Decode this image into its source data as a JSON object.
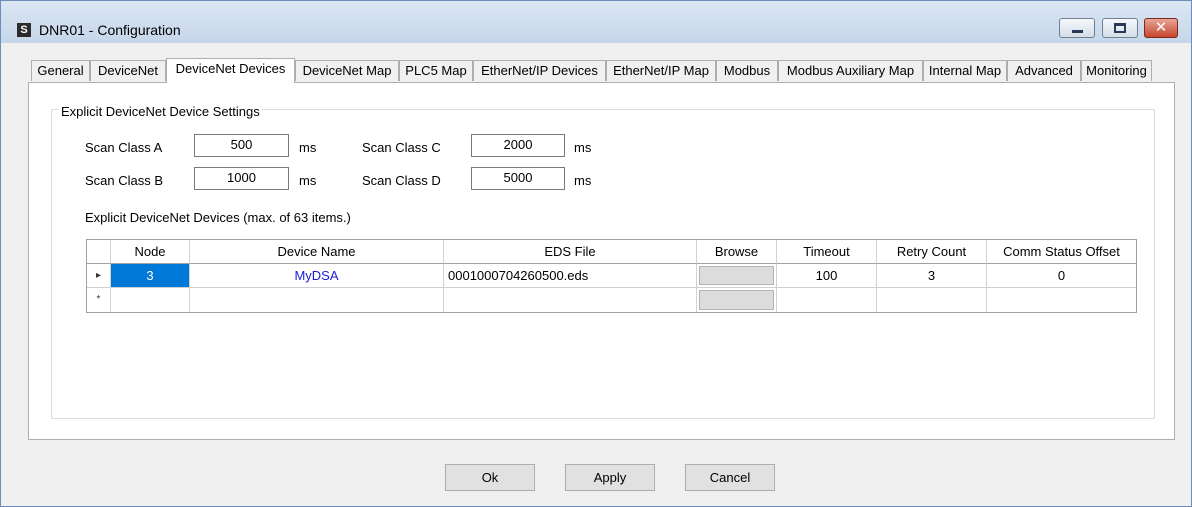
{
  "window": {
    "icon_glyph": "S",
    "title": "DNR01 - Configuration",
    "controls": {
      "minimize_icon": "minimize-icon",
      "maximize_icon": "maximize-icon",
      "close_icon": "close-icon",
      "close_glyph": "✕"
    }
  },
  "tabs": [
    {
      "label": "General"
    },
    {
      "label": "DeviceNet"
    },
    {
      "label": "DeviceNet Devices"
    },
    {
      "label": "DeviceNet Map"
    },
    {
      "label": "PLC5 Map"
    },
    {
      "label": "EtherNet/IP Devices"
    },
    {
      "label": "EtherNet/IP Map"
    },
    {
      "label": "Modbus"
    },
    {
      "label": "Modbus Auxiliary Map"
    },
    {
      "label": "Internal Map"
    },
    {
      "label": "Advanced"
    },
    {
      "label": "Monitoring"
    }
  ],
  "active_tab": "DeviceNet Devices",
  "settings": {
    "group_title": "Explicit DeviceNet Device Settings",
    "scan_a": {
      "label": "Scan Class A",
      "value": "500",
      "unit": "ms"
    },
    "scan_b": {
      "label": "Scan Class B",
      "value": "1000",
      "unit": "ms"
    },
    "scan_c": {
      "label": "Scan Class C",
      "value": "2000",
      "unit": "ms"
    },
    "scan_d": {
      "label": "Scan Class D",
      "value": "5000",
      "unit": "ms"
    },
    "devices_label": "Explicit DeviceNet Devices (max. of 63 items.)"
  },
  "grid": {
    "columns": [
      "Node",
      "Device Name",
      "EDS File",
      "Browse",
      "Timeout",
      "Retry Count",
      "Comm Status Offset"
    ],
    "row1": {
      "indicator": "▸",
      "node": "3",
      "device_name": "MyDSA",
      "eds_file": "0001000704260500.eds",
      "timeout": "100",
      "retry_count": "3",
      "comm_status_offset": "0"
    },
    "row2": {
      "indicator": "*"
    }
  },
  "buttons": {
    "ok": "Ok",
    "apply": "Apply",
    "cancel": "Cancel"
  },
  "colors": {
    "selection": "#0078d7",
    "link_text": "#1a1ad7",
    "title_bar": "#c6d6ea"
  }
}
